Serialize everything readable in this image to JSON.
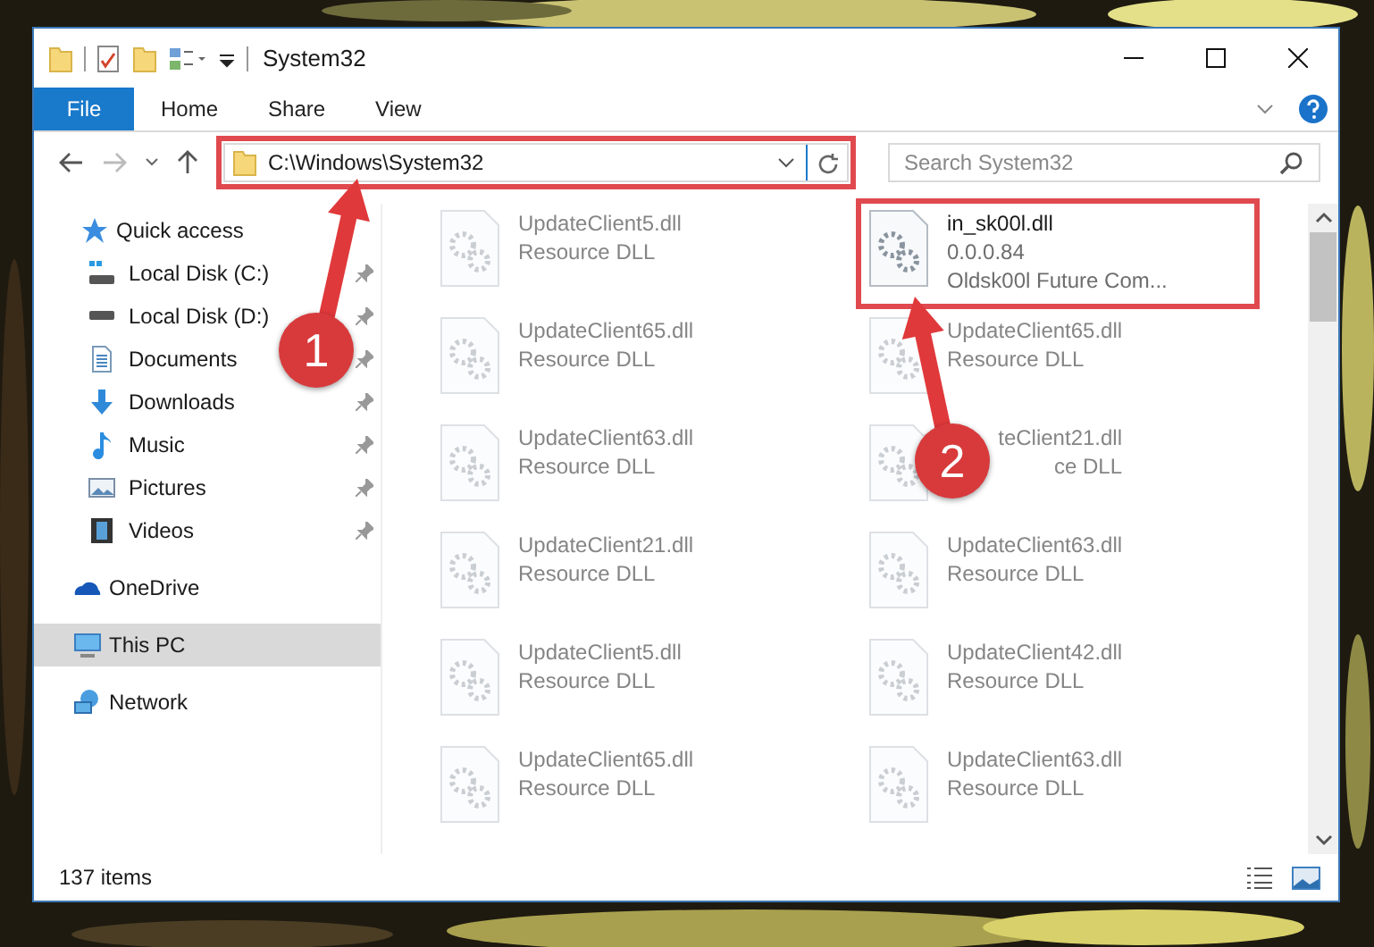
{
  "window": {
    "title": "System32"
  },
  "ribbon": {
    "tabs": [
      {
        "label": "File",
        "kind": "file",
        "selected": false
      },
      {
        "label": "Home",
        "kind": "tab",
        "selected": false
      },
      {
        "label": "Share",
        "kind": "tab",
        "selected": false
      },
      {
        "label": "View",
        "kind": "tab",
        "selected": false
      }
    ]
  },
  "address_bar": {
    "path": "C:\\Windows\\System32",
    "marked": true
  },
  "search": {
    "placeholder": "Search System32"
  },
  "sidebar": {
    "items": [
      {
        "label": "Quick access",
        "kind": "star",
        "selected": false,
        "children": [
          {
            "label": "Local Disk (C:)",
            "kind": "systemdrive",
            "pinned": true,
            "selected": false
          },
          {
            "label": "Local Disk (D:)",
            "kind": "drive",
            "pinned": true,
            "selected": false
          },
          {
            "label": "Documents",
            "kind": "documents",
            "pinned": true,
            "selected": false
          },
          {
            "label": "Downloads",
            "kind": "downloads",
            "pinned": true,
            "selected": false
          },
          {
            "label": "Music",
            "kind": "music",
            "pinned": true,
            "selected": false
          },
          {
            "label": "Pictures",
            "kind": "pictures",
            "pinned": true,
            "selected": false
          },
          {
            "label": "Videos",
            "kind": "videos",
            "pinned": true,
            "selected": false
          }
        ]
      },
      {
        "label": "OneDrive",
        "kind": "cloud",
        "selected": false
      },
      {
        "label": "This PC",
        "kind": "computer",
        "selected": true
      },
      {
        "label": "Network",
        "kind": "network",
        "selected": false
      }
    ]
  },
  "files": [
    {
      "name": "UpdateClient5.dll",
      "lines": [
        "Resource DLL"
      ],
      "blurred": true,
      "marked": false
    },
    {
      "name": "in_sk00l.dll",
      "lines": [
        "0.0.0.84",
        "Oldsk00l Future Com..."
      ],
      "blurred": false,
      "marked": true
    },
    {
      "name": "UpdateClient65.dll",
      "lines": [
        "Resource DLL"
      ],
      "blurred": true,
      "marked": false
    },
    {
      "name": "UpdateClient65.dll",
      "lines": [
        "Resource DLL"
      ],
      "blurred": true,
      "marked": false
    },
    {
      "name": "UpdateClient63.dll",
      "lines": [
        "Resource DLL"
      ],
      "blurred": true,
      "marked": false
    },
    {
      "name": "teClient21.dll",
      "lines": [
        "ce DLL"
      ],
      "blurred": true,
      "marked": false,
      "covered": true
    },
    {
      "name": "UpdateClient21.dll",
      "lines": [
        "Resource DLL"
      ],
      "blurred": true,
      "marked": false
    },
    {
      "name": "UpdateClient63.dll",
      "lines": [
        "Resource DLL"
      ],
      "blurred": true,
      "marked": false
    },
    {
      "name": "UpdateClient5.dll",
      "lines": [
        "Resource DLL"
      ],
      "blurred": true,
      "marked": false
    },
    {
      "name": "UpdateClient42.dll",
      "lines": [
        "Resource DLL"
      ],
      "blurred": true,
      "marked": false
    },
    {
      "name": "UpdateClient65.dll",
      "lines": [
        "Resource DLL"
      ],
      "blurred": true,
      "marked": false
    },
    {
      "name": "UpdateClient63.dll",
      "lines": [
        "Resource DLL"
      ],
      "blurred": true,
      "marked": false
    }
  ],
  "status_bar": {
    "count": "137 items"
  },
  "annotations": [
    {
      "label": "1"
    },
    {
      "label": "2"
    }
  ]
}
